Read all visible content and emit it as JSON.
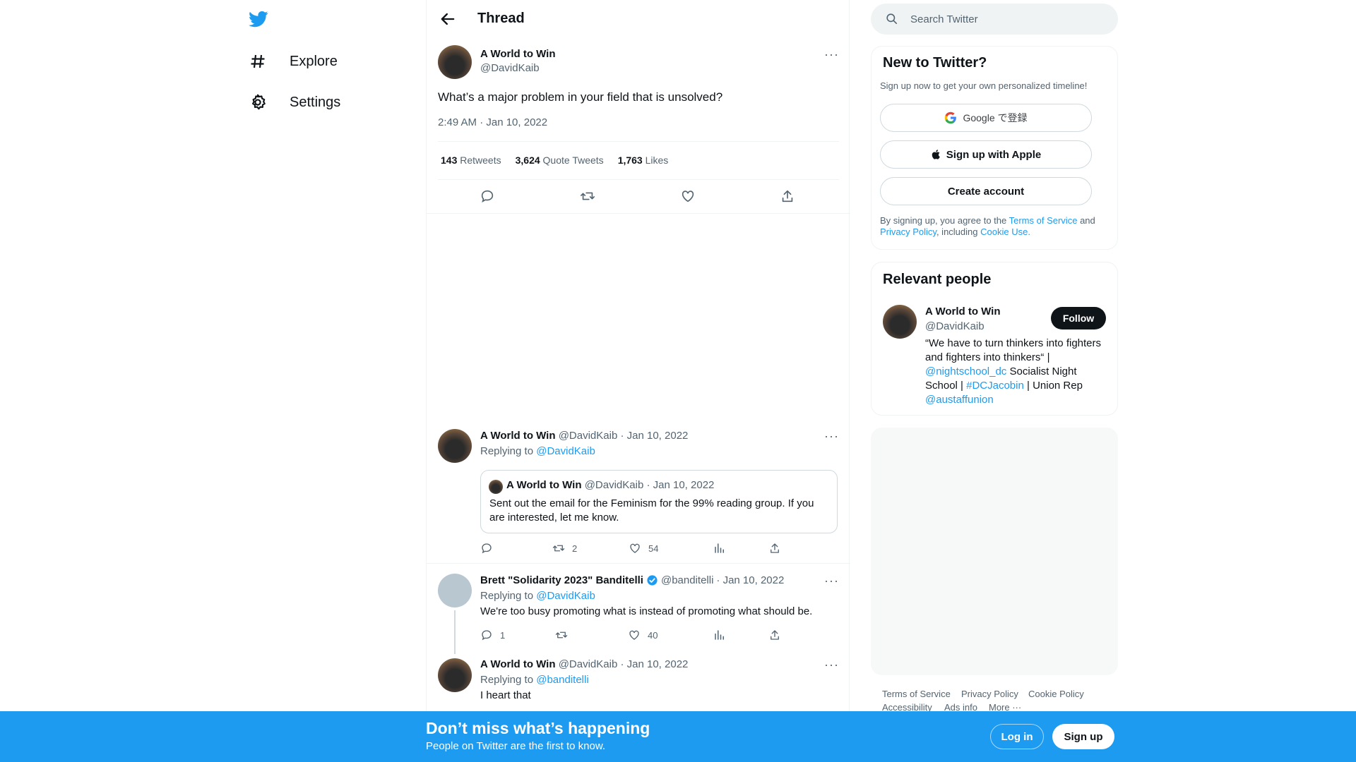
{
  "nav": {
    "items": [
      {
        "label": "Explore",
        "icon": "hashtag-icon"
      },
      {
        "label": "Settings",
        "icon": "gear-icon"
      }
    ]
  },
  "header": {
    "title": "Thread"
  },
  "main_tweet": {
    "name": "A World to Win",
    "handle": "@DavidKaib",
    "text": "What’s a major problem in your field that is unsolved?",
    "timestamp": "2:49 AM · Jan 10, 2022",
    "stats": {
      "retweets_count": "143",
      "retweets_label": "Retweets",
      "quotes_count": "3,624",
      "quotes_label": "Quote Tweets",
      "likes_count": "1,763",
      "likes_label": "Likes"
    }
  },
  "replies": [
    {
      "name": "A World to Win",
      "handle": "@DavidKaib",
      "date": "· Jan 10, 2022",
      "replying_prefix": "Replying to",
      "replying_to": "@DavidKaib",
      "quote": {
        "name": "A World to Win",
        "handle": "@DavidKaib",
        "date": "· Jan 10, 2022",
        "text": "Sent out the email for the Feminism for the 99% reading group. If you are interested, let me know."
      },
      "retweets": "2",
      "likes": "54"
    },
    {
      "name": "Brett \"Solidarity 2023\" Banditelli",
      "handle": "@banditelli",
      "date": "· Jan 10, 2022",
      "replying_prefix": "Replying to",
      "replying_to": "@DavidKaib",
      "text": "We're too busy promoting what is instead of promoting what should be.",
      "replies": "1",
      "likes": "40"
    },
    {
      "name": "A World to Win",
      "handle": "@DavidKaib",
      "date": "· Jan 10, 2022",
      "replying_prefix": "Replying to",
      "replying_to": "@banditelli",
      "text": "I heart that"
    }
  ],
  "search": {
    "placeholder": "Search Twitter"
  },
  "new_to_twitter": {
    "title": "New to Twitter?",
    "subtitle": "Sign up now to get your own personalized timeline!",
    "google_label": "Google で登録",
    "apple_label": "Sign up with Apple",
    "create_label": "Create account",
    "legal_prefix": "By signing up, you agree to the",
    "terms": "Terms of Service",
    "and": "and",
    "privacy": "Privacy Policy",
    "including": ", including",
    "cookie": "Cookie Use."
  },
  "relevant_people": {
    "title": "Relevant people",
    "name": "A World to Win",
    "handle": "@DavidKaib",
    "follow_label": "Follow",
    "bio_1": "“We have to turn thinkers into fighters and fighters into thinkers“ |",
    "bio_link_1": "@nightschool_dc",
    "bio_2": "Socialist Night School |",
    "bio_link_2": "#DCJacobin",
    "bio_3": "| Union Rep",
    "bio_link_3": "@austaffunion"
  },
  "footer_links": [
    "Terms of Service",
    "Privacy Policy",
    "Cookie Policy",
    "Accessibility",
    "Ads info",
    "More ···"
  ],
  "bottom_bar": {
    "heading": "Don’t miss what’s happening",
    "sub": "People on Twitter are the first to know.",
    "login_label": "Log in",
    "signup_label": "Sign up"
  },
  "colors": {
    "accent": "#1d9bf0",
    "text": "#0f1419",
    "muted": "#536471",
    "border": "#eff3f4"
  }
}
